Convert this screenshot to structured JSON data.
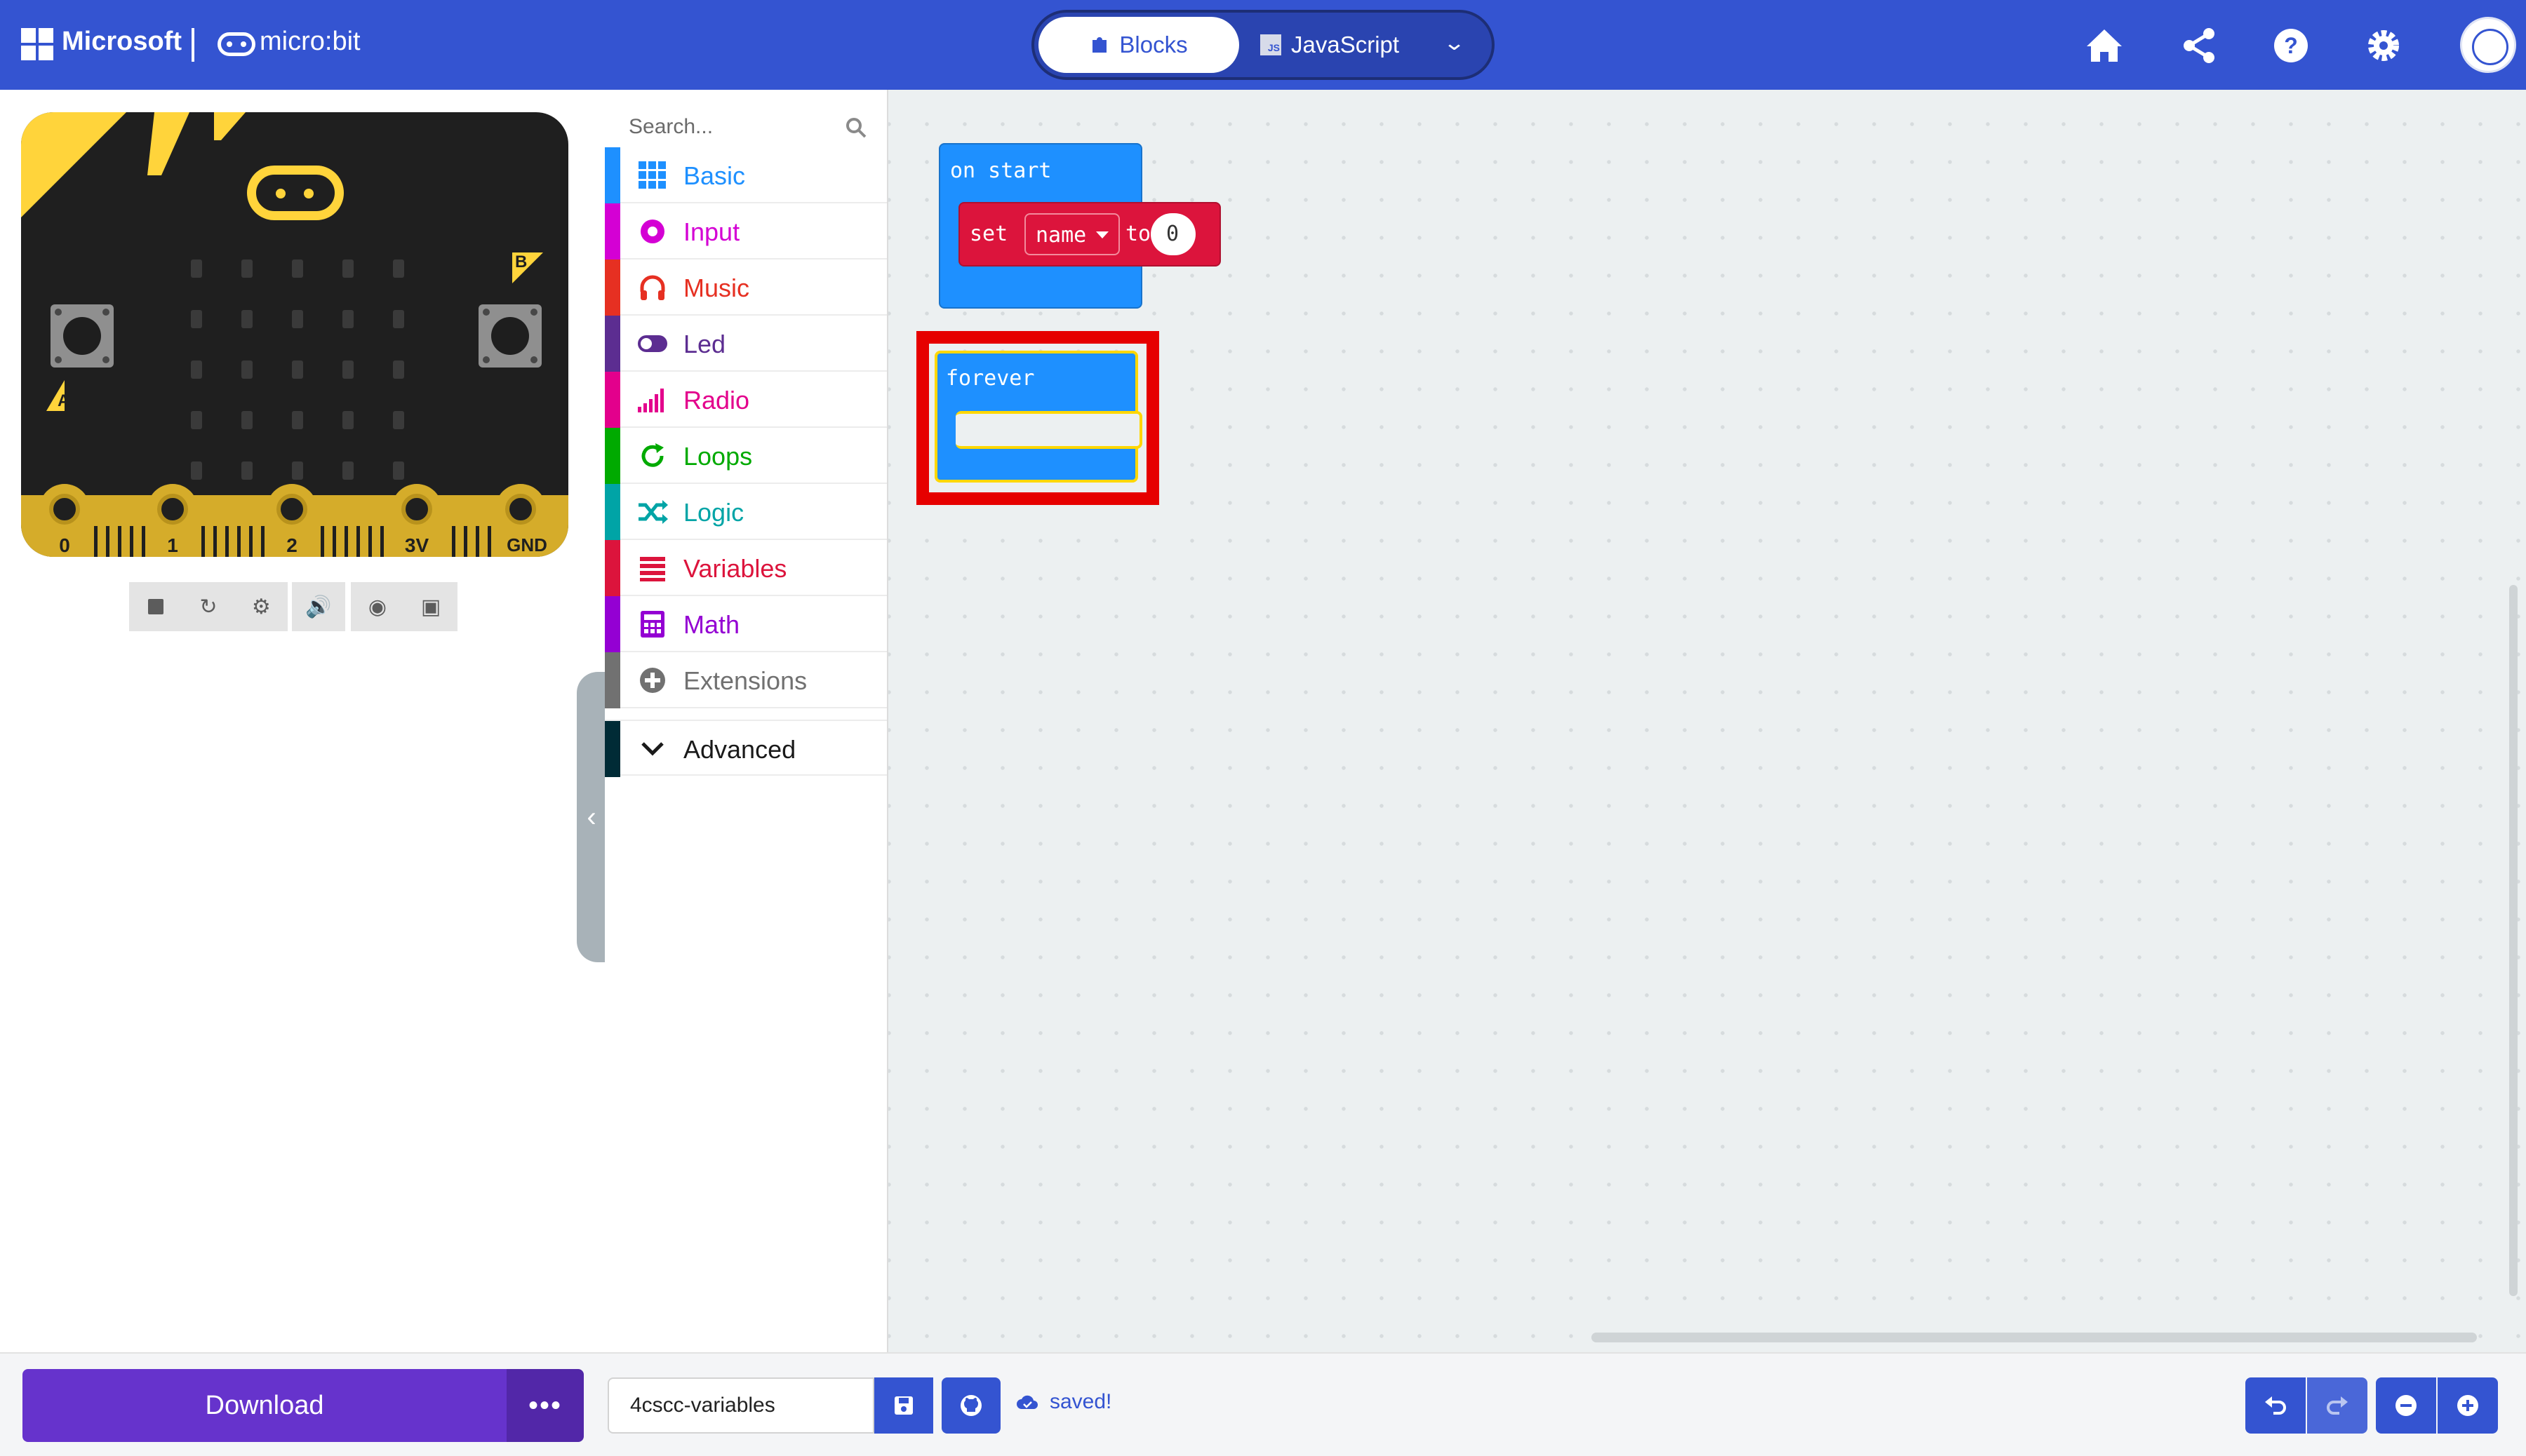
{
  "header": {
    "brand": "Microsoft",
    "product": "micro:bit",
    "modes": {
      "blocks": "Blocks",
      "javascript": "JavaScript",
      "js_badge": "JS"
    }
  },
  "simulator": {
    "pin_labels": [
      "0",
      "1",
      "2",
      "3V",
      "GND"
    ],
    "button_a": "A",
    "button_b": "B",
    "toolbar_icons": [
      "stop-icon",
      "restart-icon",
      "debug-icon",
      "mute-icon",
      "screenshot-icon",
      "fullscreen-icon"
    ]
  },
  "toolbox": {
    "search_placeholder": "Search...",
    "categories": [
      {
        "label": "Basic",
        "color": "#1e90ff",
        "icon": "grid-icon"
      },
      {
        "label": "Input",
        "color": "#d400d4",
        "icon": "target-icon"
      },
      {
        "label": "Music",
        "color": "#e63022",
        "icon": "headphones-icon"
      },
      {
        "label": "Led",
        "color": "#5c2d91",
        "icon": "toggle-icon"
      },
      {
        "label": "Radio",
        "color": "#e3008c",
        "icon": "signal-bars-icon"
      },
      {
        "label": "Loops",
        "color": "#00aa00",
        "icon": "loop-arrow-icon"
      },
      {
        "label": "Logic",
        "color": "#00a4a6",
        "icon": "shuffle-icon"
      },
      {
        "label": "Variables",
        "color": "#dc143c",
        "icon": "list-icon"
      },
      {
        "label": "Math",
        "color": "#9400d3",
        "icon": "calculator-icon"
      },
      {
        "label": "Extensions",
        "color": "#717171",
        "icon": "plus-circle-icon"
      }
    ],
    "advanced": {
      "label": "Advanced",
      "color": "#002b36"
    }
  },
  "workspace": {
    "on_start": "on start",
    "set_block": {
      "set": "set",
      "variable": "name",
      "to": "to",
      "value": "0"
    },
    "forever": "forever"
  },
  "footer": {
    "download": "Download",
    "more": "•••",
    "project_name": "4cscc-variables",
    "status": "saved!"
  }
}
